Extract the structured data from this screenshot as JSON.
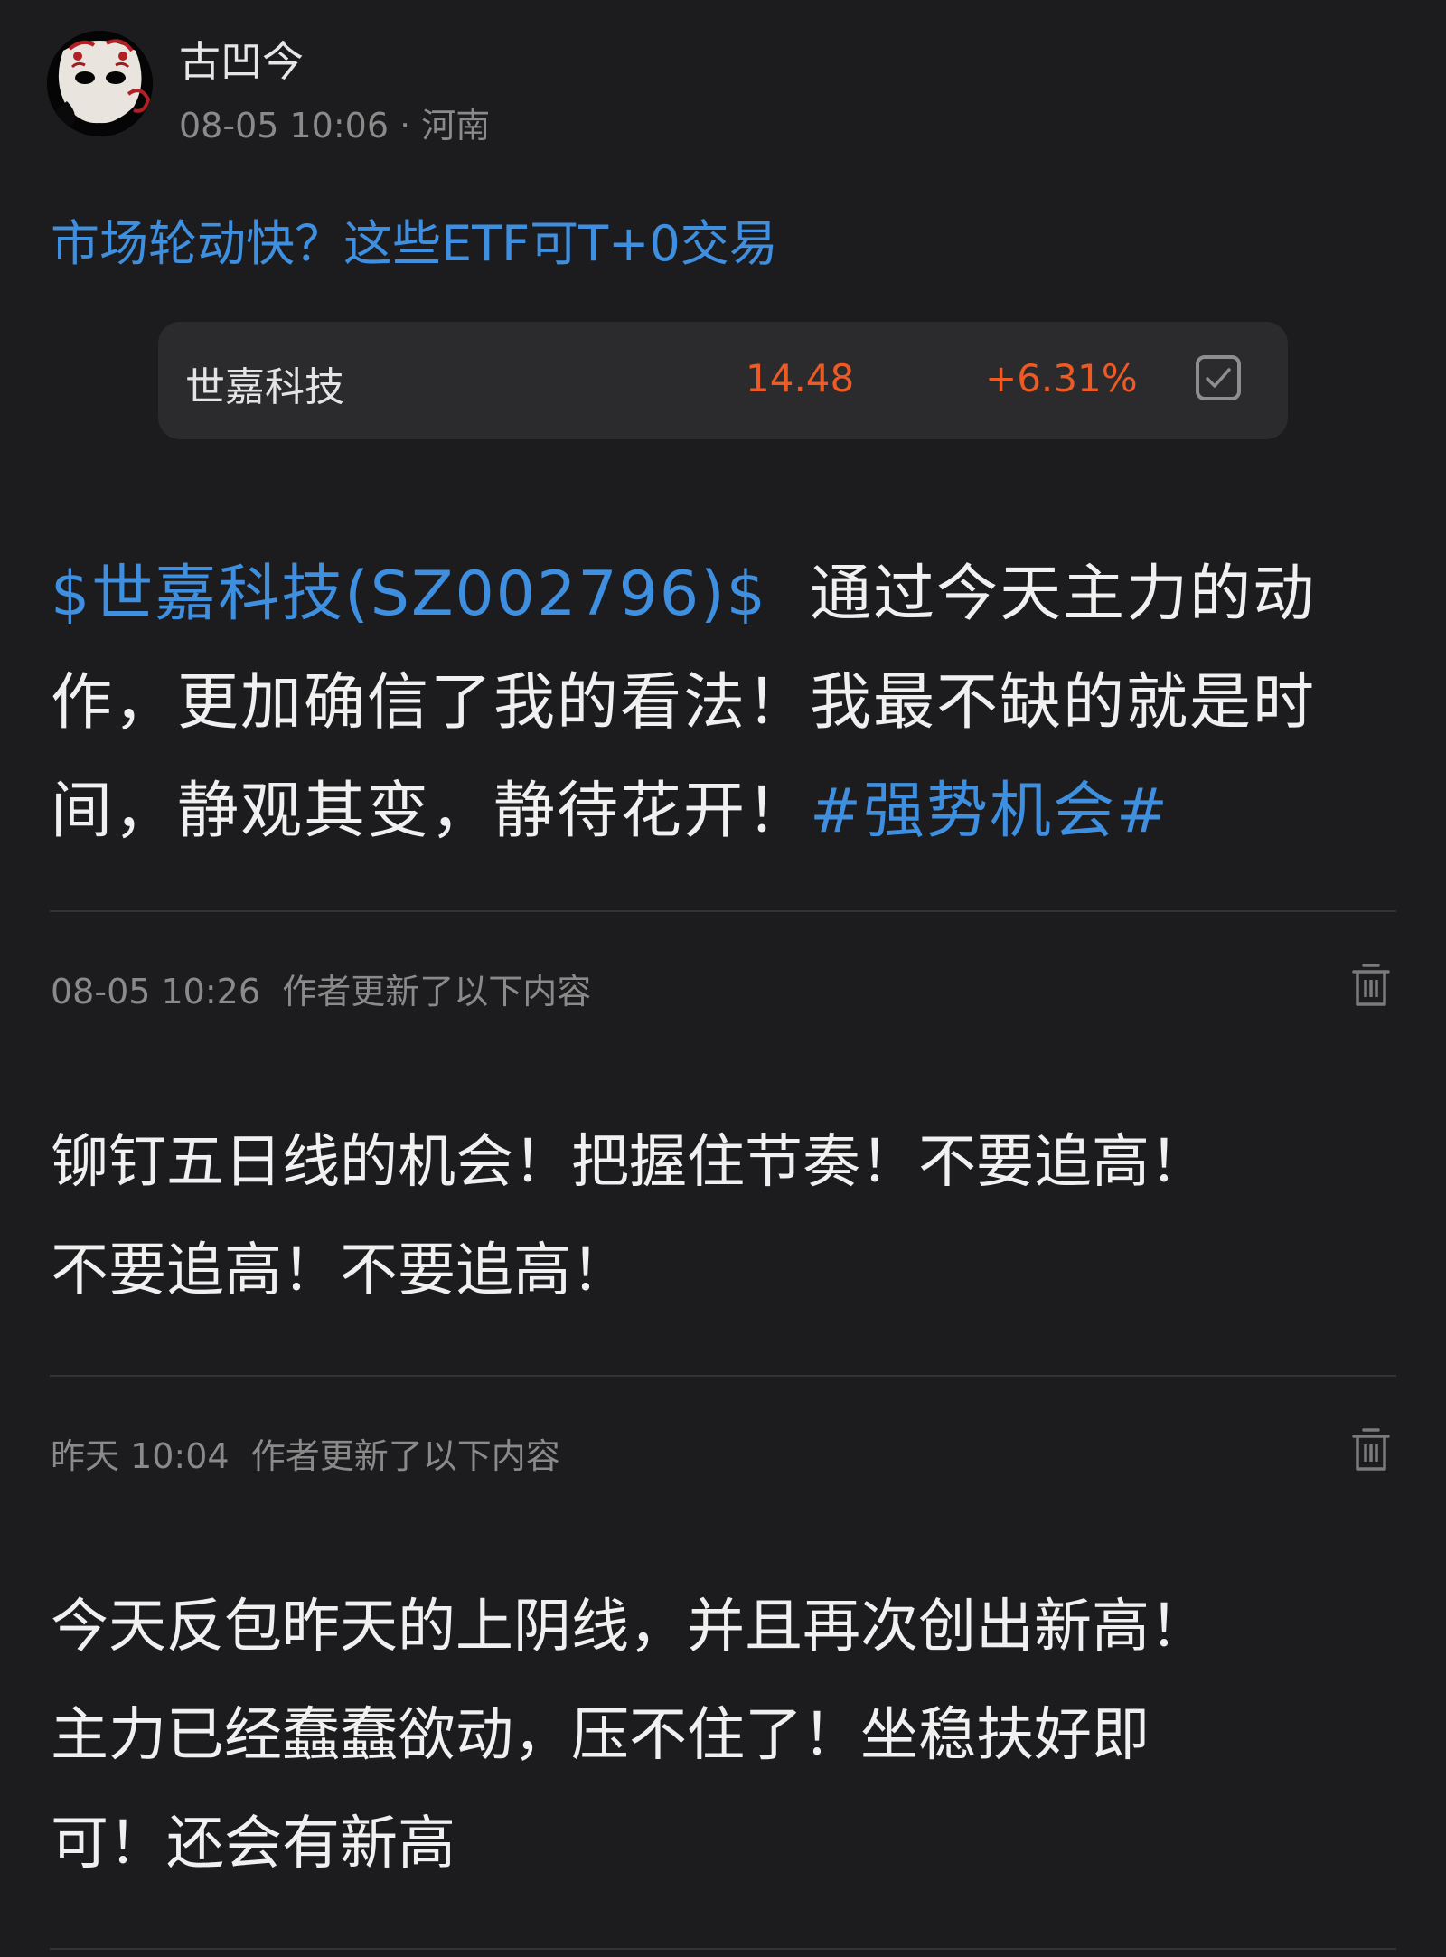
{
  "author": {
    "name": "古凹今",
    "time": "08-05 10:06",
    "separator": "·",
    "location": "河南"
  },
  "headline_link": "市场轮动快？这些ETF可T+0交易",
  "stock_card": {
    "name": "世嘉科技",
    "price": "14.48",
    "change": "+6.31%",
    "watched": true
  },
  "post": {
    "ticker": "$世嘉科技(SZ002796)$",
    "line1_rest": "通过今天主力的动",
    "line2": "作，更加确信了我的看法！我最不缺的就是时",
    "line3_text": "间，静观其变，静待花开！",
    "hashtag": "#强势机会#"
  },
  "updates": [
    {
      "time": "08-05 10:26",
      "label": "作者更新了以下内容",
      "lines": [
        "铆钉五日线的机会！把握住节奏！不要追高！",
        "不要追高！不要追高！"
      ]
    },
    {
      "time": "昨天 10:04",
      "label": "作者更新了以下内容",
      "lines": [
        "今天反包昨天的上阴线，并且再次创出新高！",
        "主力已经蠢蠢欲动，压不住了！坐稳扶好即",
        "可！还会有新高"
      ]
    }
  ],
  "colors": {
    "background": "#1c1c1e",
    "link": "#3f8fe0",
    "rise": "#ee5a24",
    "muted": "#8a8a8a",
    "card": "#2b2b2e"
  },
  "icons": {
    "avatar": "mask-avatar",
    "watch": "checkbox-checked-icon",
    "delete": "trash-icon"
  }
}
